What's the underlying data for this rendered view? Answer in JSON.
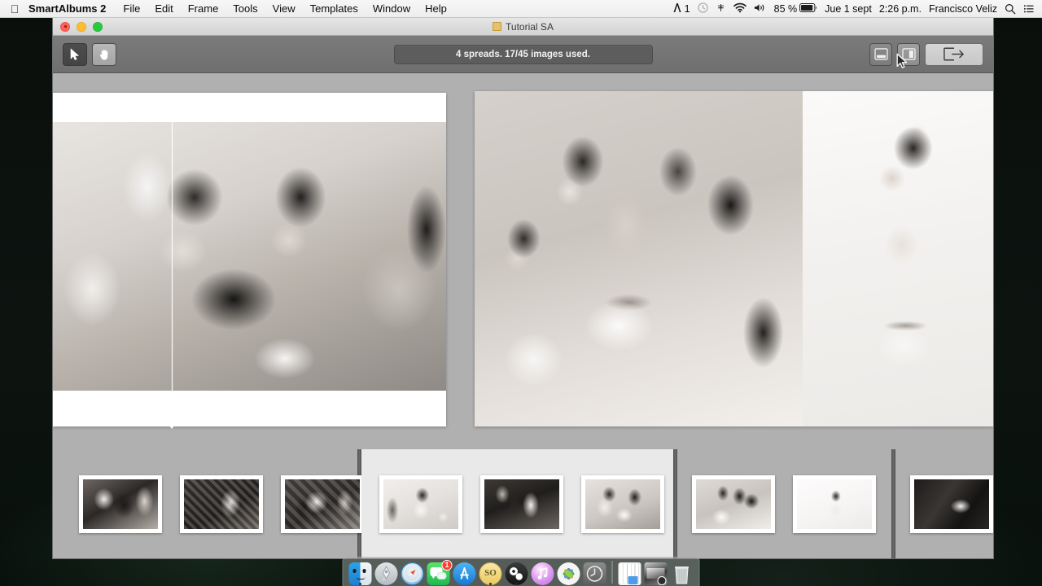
{
  "menubar": {
    "apple_icon": "apple-logo",
    "items": [
      "SmartAlbums 2",
      "File",
      "Edit",
      "Frame",
      "Tools",
      "View",
      "Templates",
      "Window",
      "Help"
    ],
    "status": {
      "alfred_count": "1",
      "battery_percent": "85 %",
      "date": "Jue 1 sept",
      "time": "2:26 p.m.",
      "user": "Francisco Veliz",
      "search_icon": "search-icon",
      "notification_icon": "notification-center-icon",
      "clock_icon": "clock-icon",
      "dropbox_icon": "dropbox-icon",
      "wifi_icon": "wifi-icon",
      "volume_icon": "volume-icon",
      "battery_icon": "battery-icon"
    }
  },
  "window": {
    "title": "Tutorial SA",
    "doc_icon": "document-icon",
    "close_label": "",
    "minimize_label": "",
    "zoom_label": ""
  },
  "toolbar": {
    "select_tool": "arrow-cursor-icon",
    "hand_tool": "hand-icon",
    "status": "4 spreads. 17/45 images used.",
    "view_single": "single-page-view-icon",
    "view_spread": "two-page-view-icon",
    "export": "export-icon"
  },
  "canvas": {
    "spreads": [
      {
        "name": "spread-1",
        "photos": [
          {
            "name": "bride-reading-letter-with-friend"
          }
        ],
        "fold_guide": true
      },
      {
        "name": "spread-2",
        "photos": [
          {
            "name": "bridesmaids-fastening-dress"
          },
          {
            "name": "bride-earrings-white-background"
          }
        ]
      }
    ]
  },
  "filmstrip": {
    "groups": [
      {
        "name": "spread-group-1",
        "selected": false,
        "thumbs": [
          {
            "name": "thumb-couple-mirror-1"
          },
          {
            "name": "thumb-bride-mirror-ornate"
          },
          {
            "name": "thumb-couple-dance-mirror"
          }
        ]
      },
      {
        "name": "spread-group-2",
        "selected": true,
        "thumbs": [
          {
            "name": "thumb-bride-coffee"
          },
          {
            "name": "thumb-bride-veil-window"
          },
          {
            "name": "thumb-bride-reading-letter"
          }
        ]
      },
      {
        "name": "spread-group-3",
        "selected": false,
        "thumbs": [
          {
            "name": "thumb-dress-fastening"
          },
          {
            "name": "thumb-bride-earrings"
          }
        ]
      },
      {
        "name": "spread-group-4",
        "selected": false,
        "thumbs": [
          {
            "name": "thumb-couple-bed-overhead"
          }
        ]
      }
    ]
  },
  "dock": {
    "items": [
      {
        "name": "finder",
        "running": true,
        "badge": ""
      },
      {
        "name": "launchpad",
        "running": false,
        "badge": ""
      },
      {
        "name": "safari",
        "running": false,
        "badge": ""
      },
      {
        "name": "messages",
        "running": false,
        "badge": "1"
      },
      {
        "name": "app-store",
        "running": false,
        "badge": ""
      },
      {
        "name": "smartalbums",
        "running": true,
        "badge": ""
      },
      {
        "name": "obs",
        "running": true,
        "badge": ""
      },
      {
        "name": "itunes",
        "running": false,
        "badge": ""
      },
      {
        "name": "photos",
        "running": false,
        "badge": ""
      },
      {
        "name": "time-machine",
        "running": false,
        "badge": ""
      }
    ],
    "right_items": [
      {
        "name": "calendar-folder"
      },
      {
        "name": "screenshot-file"
      },
      {
        "name": "trash"
      }
    ]
  },
  "colors": {
    "menubar_bg": "#f2f2f2",
    "toolbar_bg": "#757575",
    "canvas_bg": "#b0b0b0",
    "selected_strip": "#e9e9e9",
    "badge_red": "#ff3b30"
  }
}
